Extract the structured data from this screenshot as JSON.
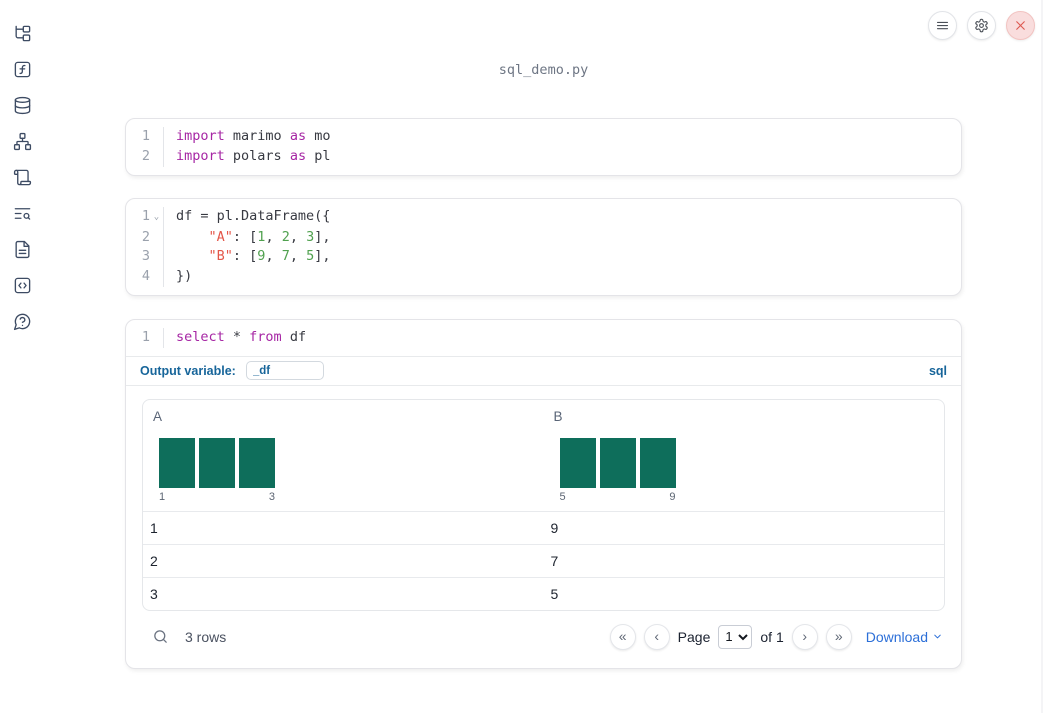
{
  "window": {
    "title": "sql_demo.py"
  },
  "topbar": {
    "menu_button": "notebook-menu",
    "settings_button": "settings",
    "shutdown_button": "shutdown"
  },
  "sidebar": {
    "icons": [
      "file-explorer",
      "variables",
      "data-sources",
      "dependency-graph",
      "scratchpad",
      "logs-search",
      "documentation",
      "snippets",
      "help"
    ]
  },
  "colors": {
    "keyword": "#a626a4",
    "string": "#e45649",
    "number": "#50a14f",
    "code_text": "#383a42",
    "histogram_bar": "#0e6e5b",
    "sql_accent": "#17659a",
    "link_blue": "#2c6fd8",
    "danger": "#dd5a52"
  },
  "cells": [
    {
      "type": "python",
      "lines": [
        {
          "num": "1",
          "segments": [
            [
              "kw",
              "import"
            ],
            [
              "pl",
              " marimo "
            ],
            [
              "kw",
              "as"
            ],
            [
              "pl",
              " mo"
            ]
          ]
        },
        {
          "num": "2",
          "segments": [
            [
              "kw",
              "import"
            ],
            [
              "pl",
              " polars "
            ],
            [
              "kw",
              "as"
            ],
            [
              "pl",
              " pl"
            ]
          ]
        }
      ]
    },
    {
      "type": "python",
      "lines": [
        {
          "num": "1",
          "fold": true,
          "segments": [
            [
              "pl",
              "df = pl.DataFrame({"
            ]
          ]
        },
        {
          "num": "2",
          "segments": [
            [
              "pl",
              "    "
            ],
            [
              "str",
              "\"A\""
            ],
            [
              "pl",
              ": ["
            ],
            [
              "num",
              "1"
            ],
            [
              "pl",
              ", "
            ],
            [
              "num",
              "2"
            ],
            [
              "pl",
              ", "
            ],
            [
              "num",
              "3"
            ],
            [
              "pl",
              "],"
            ]
          ]
        },
        {
          "num": "3",
          "segments": [
            [
              "pl",
              "    "
            ],
            [
              "str",
              "\"B\""
            ],
            [
              "pl",
              ": ["
            ],
            [
              "num",
              "9"
            ],
            [
              "pl",
              ", "
            ],
            [
              "num",
              "7"
            ],
            [
              "pl",
              ", "
            ],
            [
              "num",
              "5"
            ],
            [
              "pl",
              "],"
            ]
          ]
        },
        {
          "num": "4",
          "segments": [
            [
              "pl",
              "})"
            ]
          ]
        }
      ]
    },
    {
      "type": "sql",
      "lines": [
        {
          "num": "1",
          "segments": [
            [
              "kw",
              "select"
            ],
            [
              "pl",
              " * "
            ],
            [
              "kw",
              "from"
            ],
            [
              "pl",
              " df"
            ]
          ]
        }
      ],
      "footer": {
        "label": "Output variable:",
        "value": "_df",
        "badge": "sql"
      }
    }
  ],
  "table": {
    "columns": [
      {
        "name": "A",
        "histogram": {
          "bar_heights": [
            1,
            1,
            1
          ],
          "min_label": "1",
          "max_label": "3"
        }
      },
      {
        "name": "B",
        "histogram": {
          "bar_heights": [
            1,
            1,
            1
          ],
          "min_label": "5",
          "max_label": "9"
        }
      }
    ],
    "rows": [
      [
        "1",
        "9"
      ],
      [
        "2",
        "7"
      ],
      [
        "3",
        "5"
      ]
    ],
    "footer": {
      "row_count": "3 rows",
      "page_label": "Page",
      "page_value": "1",
      "of_label": "of 1",
      "download_label": "Download",
      "pagination": {
        "first": "«",
        "prev": "‹",
        "next": "›",
        "last": "»"
      }
    }
  }
}
